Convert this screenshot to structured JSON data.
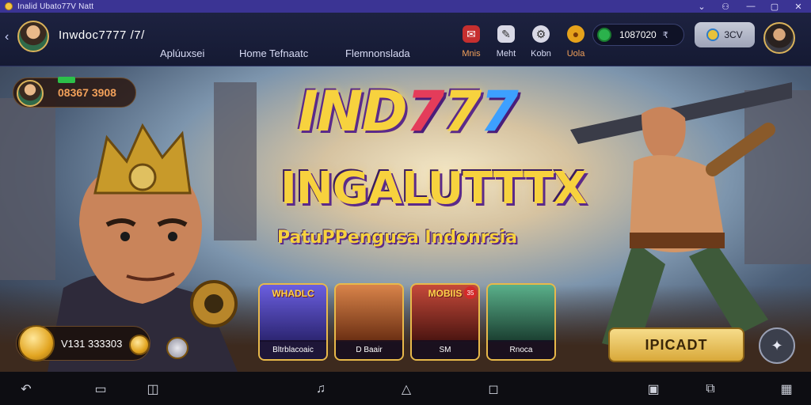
{
  "window": {
    "title": "Inalid Ubato77V Natt",
    "controls": {
      "minimize": "—",
      "restore": "▢",
      "close": "✕",
      "expand": "⌄",
      "tray": "⚇"
    }
  },
  "header": {
    "back_glyph": "‹",
    "username": "Inwdoc7777 /7/",
    "tabs": [
      "Aplúuxsei",
      "Home Tefnaatc",
      "Flemnonslada"
    ],
    "icons": [
      {
        "name": "mail-icon",
        "label": "Mnis",
        "color": "#c62f2f",
        "glyph": "✉"
      },
      {
        "name": "chat-icon",
        "label": "Meht",
        "color": "#d9d9e6",
        "glyph": "✎"
      },
      {
        "name": "settings-icon",
        "label": "Kobn",
        "color": "#d9d9e6",
        "glyph": "⚙"
      },
      {
        "name": "gift-icon",
        "label": "Uola",
        "color": "#e6a21b",
        "glyph": "●"
      }
    ],
    "wallet": {
      "amount": "1087020",
      "caret": "₹"
    },
    "sv_button": "3CV"
  },
  "hero": {
    "promo_amount": "08367 3908",
    "logo": {
      "part1": "IND",
      "part2": "7",
      "part3": "7",
      "part4": "7"
    },
    "title": "INGALUTTTX",
    "tagline": "PatuPPengusa Indonrsia",
    "cards": [
      {
        "title": "WHADLC",
        "caption": "Bltrblacoaic",
        "art": "#5a4fc9",
        "badge": ""
      },
      {
        "title": "",
        "caption": "D Baair",
        "art": "#b85a2a",
        "badge": ""
      },
      {
        "title": "MOBIIS",
        "caption": "SM",
        "art": "#a6302a",
        "badge": "35"
      },
      {
        "title": "",
        "caption": "Rnoca",
        "art": "#3e8a6a",
        "badge": ""
      }
    ],
    "coin_balance": "V131 333303",
    "cta_label": "IPICADT",
    "fab_glyph": "✦"
  },
  "navbar": {
    "items": [
      "↶",
      "▭",
      "◫",
      "♫",
      "△",
      "◻",
      "▣",
      "⧉",
      "▦"
    ]
  }
}
